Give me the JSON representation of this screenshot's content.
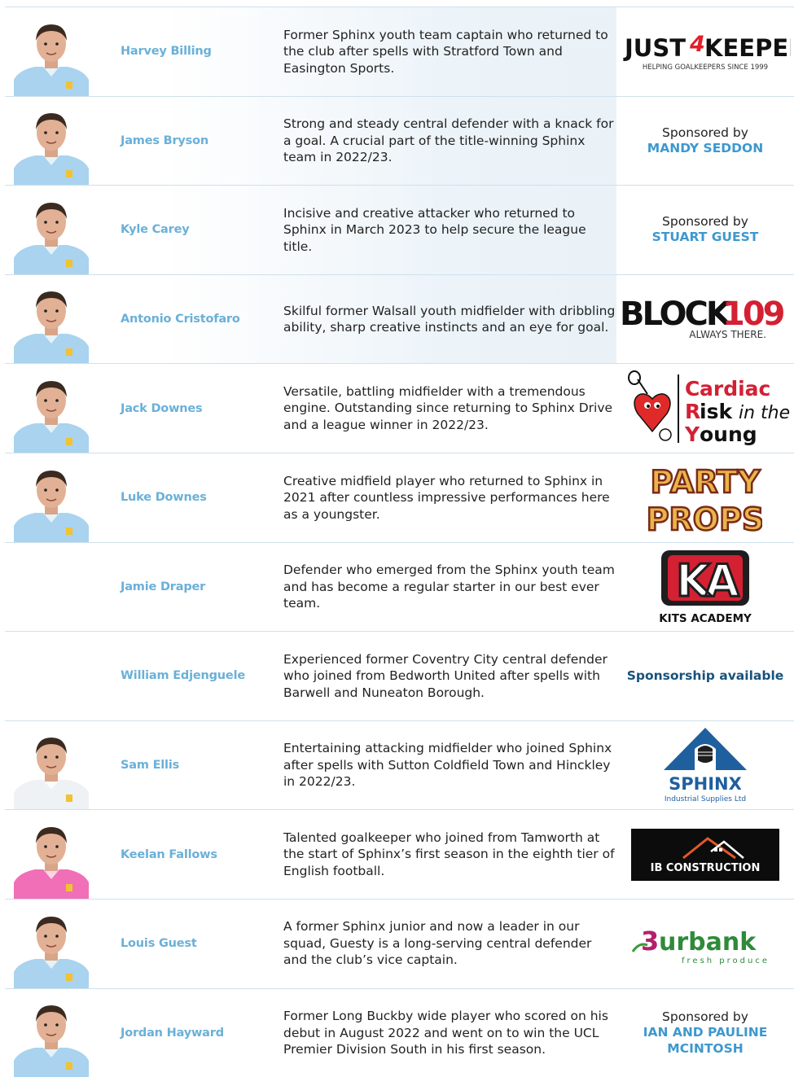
{
  "players": [
    {
      "name": "Harvey Billing",
      "desc": "Former Sphinx youth team captain who returned to the club after spells with Stratford Town and Easington Sports.",
      "photo": true,
      "kit": "sky"
    },
    {
      "name": "James Bryson",
      "desc": "Strong and steady central defender with a knack for a goal. A crucial part of the title-winning Sphinx team in 2022/23.",
      "photo": true,
      "kit": "sky"
    },
    {
      "name": "Kyle Carey",
      "desc": "Incisive and creative attacker who returned to Sphinx in March 2023 to help secure the league title.",
      "photo": true,
      "kit": "sky"
    },
    {
      "name": "Antonio Cristofaro",
      "desc": "Skilful former Walsall youth midfielder with dribbling ability, sharp creative instincts and an eye for goal.",
      "photo": true,
      "kit": "sky"
    },
    {
      "name": "Jack Downes",
      "desc": "Versatile, battling midfielder with a tremendous engine. Outstanding since returning to Sphinx Drive and a league winner in 2022/23.",
      "photo": true,
      "kit": "sky"
    },
    {
      "name": "Luke Downes",
      "desc": "Creative midfield player who returned to Sphinx in 2021 after countless impressive performances here as a youngster.",
      "photo": true,
      "kit": "sky"
    },
    {
      "name": "Jamie Draper",
      "desc": "Defender who emerged from the Sphinx youth team and has become a regular starter in our best ever team.",
      "photo": false
    },
    {
      "name": "William Edjenguele",
      "desc": "Experienced former Coventry City central defender who joined from Bedworth United after spells with Barwell and Nuneaton Borough.",
      "photo": false
    },
    {
      "name": "Sam Ellis",
      "desc": "Entertaining attacking midfielder who joined Sphinx after spells with Sutton Coldfield Town and Hinckley in 2022/23.",
      "photo": true,
      "kit": "white"
    },
    {
      "name": "Keelan Fallows",
      "desc": "Talented goalkeeper who joined from Tamworth at the start of Sphinx’s first season in the eighth tier of English football.",
      "photo": true,
      "kit": "pink"
    },
    {
      "name": "Louis Guest",
      "desc": "A former Sphinx junior and now a leader in our squad, Guesty is a long-serving central defender and the club’s vice captain.",
      "photo": true,
      "kit": "sky"
    },
    {
      "name": "Jordan Hayward",
      "desc": "Former Long Buckby wide player who scored on his debut in August 2022 and went on to win the UCL Premier Division South in his first season.",
      "photo": true,
      "kit": "sky"
    }
  ],
  "sponsors": {
    "just4keepers": {
      "word1": "JUST",
      "four": "4",
      "word2": "KEEPERS",
      "tagline": "HELPING GOALKEEPERS SINCE 1999"
    },
    "bryson": {
      "by": "Sponsored by",
      "name": "MANDY SEDDON"
    },
    "carey": {
      "by": "Sponsored by",
      "name": "STUART GUEST"
    },
    "block109": {
      "word": "BLOCK",
      "num": "109",
      "tagline": "ALWAYS THERE."
    },
    "cry": {
      "l1a": "C",
      "l1b": "ardiac",
      "l2a": "R",
      "l2b": "isk",
      "l2c": " in the",
      "l3a": "Y",
      "l3b": "oung"
    },
    "party": {
      "l1": "PARTY",
      "l2": "PROPS"
    },
    "kits": {
      "mark": "KA",
      "name": "KITS ACADEMY"
    },
    "edjenguele": {
      "avail": "Sponsorship available"
    },
    "sphinx": {
      "name": "SPHINX",
      "sub": "Industrial Supplies Ltd"
    },
    "ib": {
      "name": "IB CONSTRUCTION"
    },
    "burbank": {
      "mark": "3",
      "word": "urbank",
      "sub": "fresh  produce"
    },
    "hayward": {
      "by": "Sponsored by",
      "l1": "IAN AND PAULINE",
      "l2": "MCINTOSH"
    }
  },
  "colors": {
    "name": "#6ab0d8",
    "sponsor_blue": "#3d98cf",
    "dark_blue": "#17527d",
    "kit_sky": "#a9d3ee",
    "kit_pink": "#f06fb6"
  }
}
